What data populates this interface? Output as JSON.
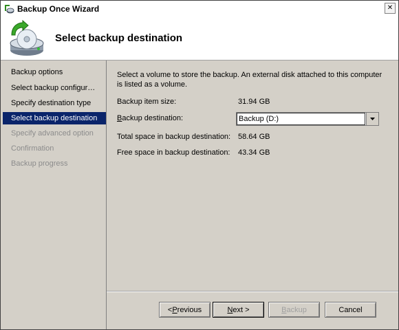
{
  "window": {
    "title": "Backup Once Wizard",
    "close_glyph": "✕"
  },
  "header": {
    "heading": "Select backup destination",
    "icon": "backup-disk-icon"
  },
  "nav": {
    "items": [
      {
        "label": "Backup options",
        "state": "done"
      },
      {
        "label": "Select backup configur…",
        "state": "done"
      },
      {
        "label": "Specify destination type",
        "state": "done"
      },
      {
        "label": "Select backup destination",
        "state": "active"
      },
      {
        "label": "Specify advanced option",
        "state": "pending"
      },
      {
        "label": "Confirmation",
        "state": "pending"
      },
      {
        "label": "Backup progress",
        "state": "pending"
      }
    ]
  },
  "content": {
    "intro": "Select a volume to store the backup. An external disk attached to this computer is listed as a volume.",
    "item_size_label": "Backup item size:",
    "item_size_value": "31.94 GB",
    "destination_label_underlined": "B",
    "destination_label_rest": "ackup destination:",
    "destination_value": "Backup (D:)",
    "total_space_label": "Total space in backup destination:",
    "total_space_value": "58.64 GB",
    "free_space_label": "Free space in backup destination:",
    "free_space_value": "43.34 GB"
  },
  "buttons": {
    "previous_prefix": "< ",
    "previous_underlined": "P",
    "previous_rest": "revious",
    "next_underlined": "N",
    "next_rest": "ext >",
    "backup_underlined": "B",
    "backup_rest": "ackup",
    "cancel": "Cancel"
  },
  "colors": {
    "nav_active_bg": "#0a246a",
    "disabled_text": "#8c8c8c",
    "face": "#d4d0c8"
  }
}
